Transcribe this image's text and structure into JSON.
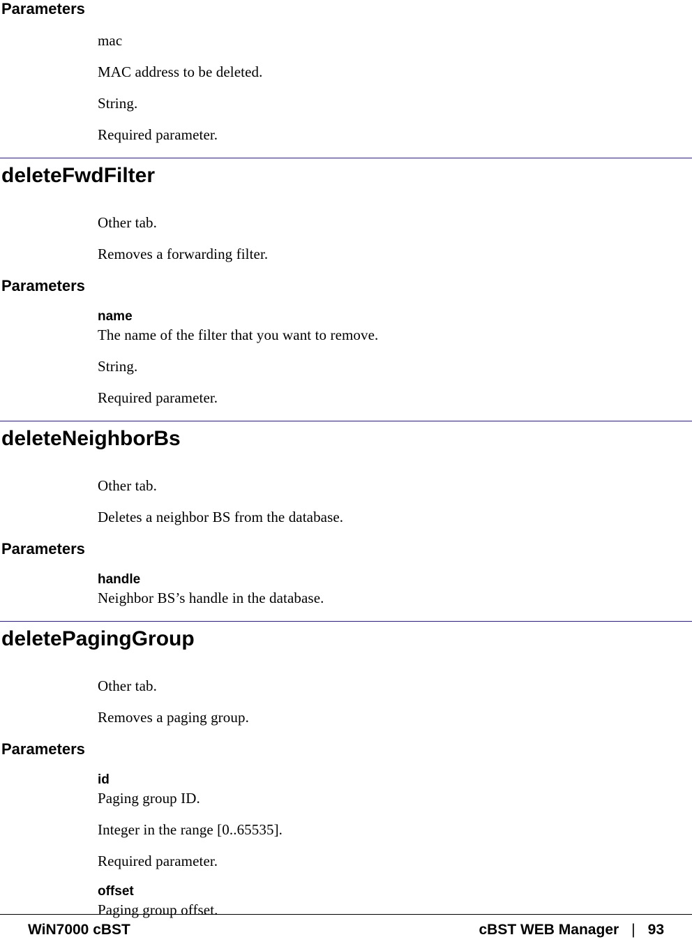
{
  "section0": {
    "parameters_heading": "Parameters",
    "p1": "mac",
    "p2": "MAC address to be deleted.",
    "p3": "String.",
    "p4": "Required parameter."
  },
  "section1": {
    "heading": "deleteFwdFilter",
    "tab": "Other tab.",
    "desc": "Removes a forwarding filter.",
    "parameters_heading": "Parameters",
    "param_name": "name",
    "param_desc": "The name of the filter that you want to remove.",
    "param_type": "String.",
    "param_req": "Required parameter."
  },
  "section2": {
    "heading": "deleteNeighborBs",
    "tab": "Other tab.",
    "desc": "Deletes a neighbor BS from the database.",
    "parameters_heading": "Parameters",
    "param_name": "handle",
    "param_desc": "Neighbor BS’s handle in the database."
  },
  "section3": {
    "heading": "deletePagingGroup",
    "tab": "Other tab.",
    "desc": "Removes a paging group.",
    "parameters_heading": "Parameters",
    "param1_name": "id",
    "param1_desc": "Paging group ID.",
    "param1_type": "Integer in the range [0..65535].",
    "param1_req": "Required parameter.",
    "param2_name": "offset",
    "param2_desc": "Paging group offset."
  },
  "footer": {
    "left": "WiN7000 cBST",
    "right_title": "cBST WEB Manager",
    "sep": "|",
    "page": "93"
  }
}
